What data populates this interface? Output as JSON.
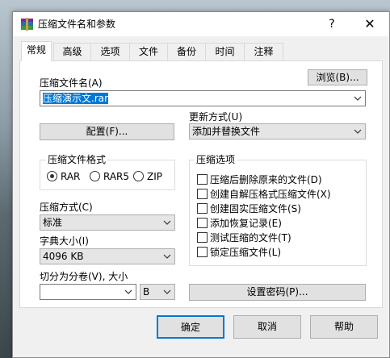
{
  "window": {
    "title": "压缩文件名和参数",
    "help": "?",
    "close": "✕"
  },
  "tabs": [
    "常规",
    "高级",
    "选项",
    "文件",
    "备份",
    "时间",
    "注释"
  ],
  "active_tab": 0,
  "archive_name": {
    "label": "压缩文件名(A)",
    "value": "压缩演示文.rar",
    "browse_button": "浏览(B)..."
  },
  "update_mode": {
    "label": "更新方式(U)",
    "value": "添加并替换文件"
  },
  "profiles_button": "配置(F)...",
  "archive_format": {
    "legend": "压缩文件格式",
    "options": [
      "RAR",
      "RAR5",
      "ZIP"
    ],
    "selected": "RAR"
  },
  "compression_method": {
    "label": "压缩方式(C)",
    "value": "标准"
  },
  "dictionary_size": {
    "label": "字典大小(I)",
    "value": "4096 KB"
  },
  "split_volumes": {
    "label": "切分为分卷(V), 大小",
    "value": "",
    "unit": "B"
  },
  "archiving_options": {
    "legend": "压缩选项",
    "items": [
      {
        "label": "压缩后删除原来的文件(D)",
        "checked": false
      },
      {
        "label": "创建自解压格式压缩文件(X)",
        "checked": false
      },
      {
        "label": "创建固实压缩文件(S)",
        "checked": false
      },
      {
        "label": "添加恢复记录(E)",
        "checked": false
      },
      {
        "label": "测试压缩的文件(T)",
        "checked": false
      },
      {
        "label": "锁定压缩文件(L)",
        "checked": false
      }
    ]
  },
  "set_password_button": "设置密码(P)...",
  "footer": {
    "ok": "确定",
    "cancel": "取消",
    "help": "帮助"
  }
}
